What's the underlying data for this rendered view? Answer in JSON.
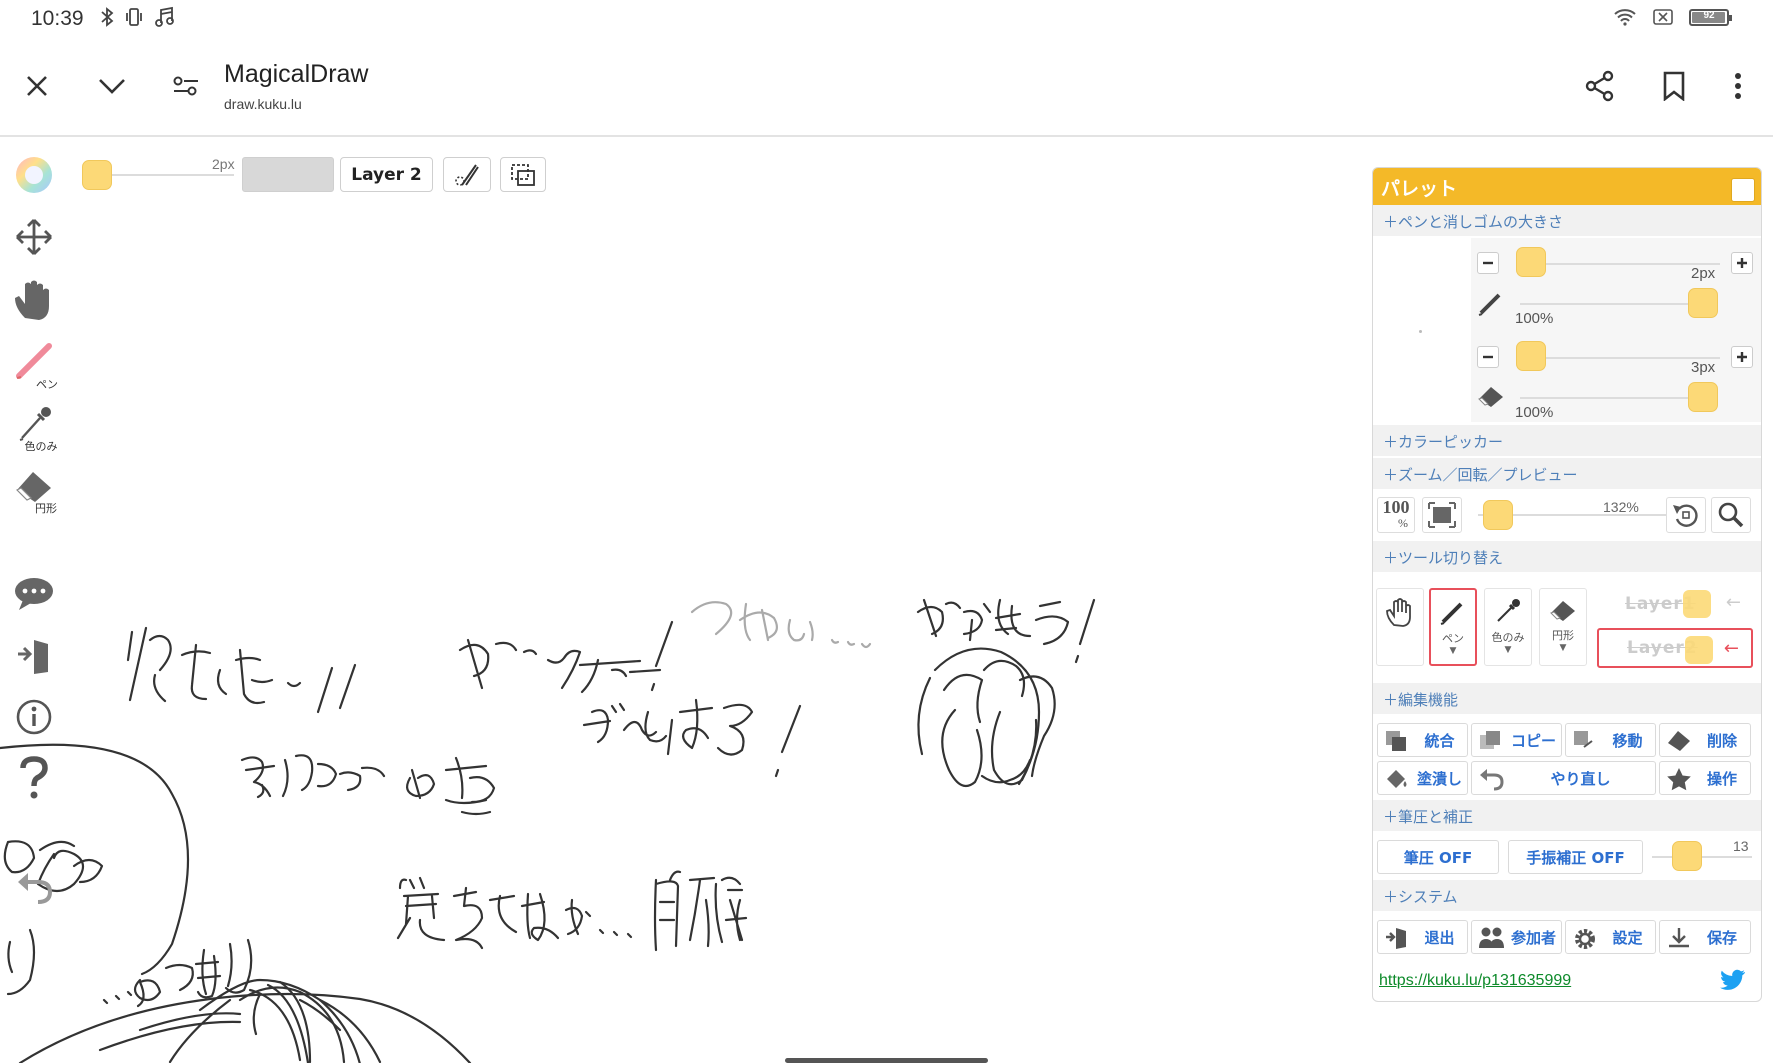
{
  "status_bar": {
    "time": "10:39",
    "left_icons": [
      "bluetooth-icon",
      "vibrate-icon",
      "music-icon"
    ],
    "right_icons": [
      "wifi-icon",
      "no-sim-icon",
      "battery-icon"
    ],
    "battery": "92"
  },
  "browser": {
    "title": "MagicalDraw",
    "url": "draw.kuku.lu",
    "icons": [
      "close-icon",
      "chevron-down-icon",
      "page-settings-icon",
      "share-icon",
      "bookmark-icon",
      "more-vert-icon"
    ]
  },
  "left_toolbar": {
    "pen_label": "ペン",
    "dropper_label": "色のみ",
    "eraser_label": "円形",
    "icons": [
      "color-wheel-icon",
      "move-icon",
      "hand-icon",
      "pen-icon",
      "dropper-icon",
      "eraser-icon",
      "chat-icon",
      "exit-icon",
      "info-icon",
      "help-icon",
      "undo-icon"
    ]
  },
  "top_toolbar": {
    "size_label": "2px",
    "layer_button": "Layer 2"
  },
  "palette": {
    "title": "パレット",
    "sections": {
      "size": "＋ペンと消しゴムの大きさ",
      "picker": "＋カラーピッカー",
      "zoom": "＋ズーム／回転／プレビュー",
      "tools": "＋ツール切り替え",
      "edit": "＋編集機能",
      "pressure": "＋筆圧と補正",
      "system": "＋システム"
    },
    "pen_size": "2px",
    "pen_opacity": "100%",
    "eraser_size": "3px",
    "eraser_opacity": "100%",
    "zoom_reset_top": "100",
    "zoom_reset_bottom": "%",
    "zoom_value": "132%",
    "tools": {
      "pen": "ペン",
      "dropper": "色のみ",
      "eraser": "円形"
    },
    "layers": [
      "Layer1",
      "Layer2"
    ],
    "edit_buttons": [
      "統合",
      "コピー",
      "移動",
      "削除",
      "塗潰し",
      "やり直し",
      "操作"
    ],
    "pressure_button": "筆圧 OFF",
    "stabilizer_button": "手振補正 OFF",
    "stabilizer_value": "13",
    "system_buttons": [
      "退出",
      "参加者",
      "設定",
      "保存"
    ],
    "link": "https://kuku.lu/p131635999"
  },
  "canvas": {
    "drawing_icon": "handwritten-sketch-drawing"
  }
}
